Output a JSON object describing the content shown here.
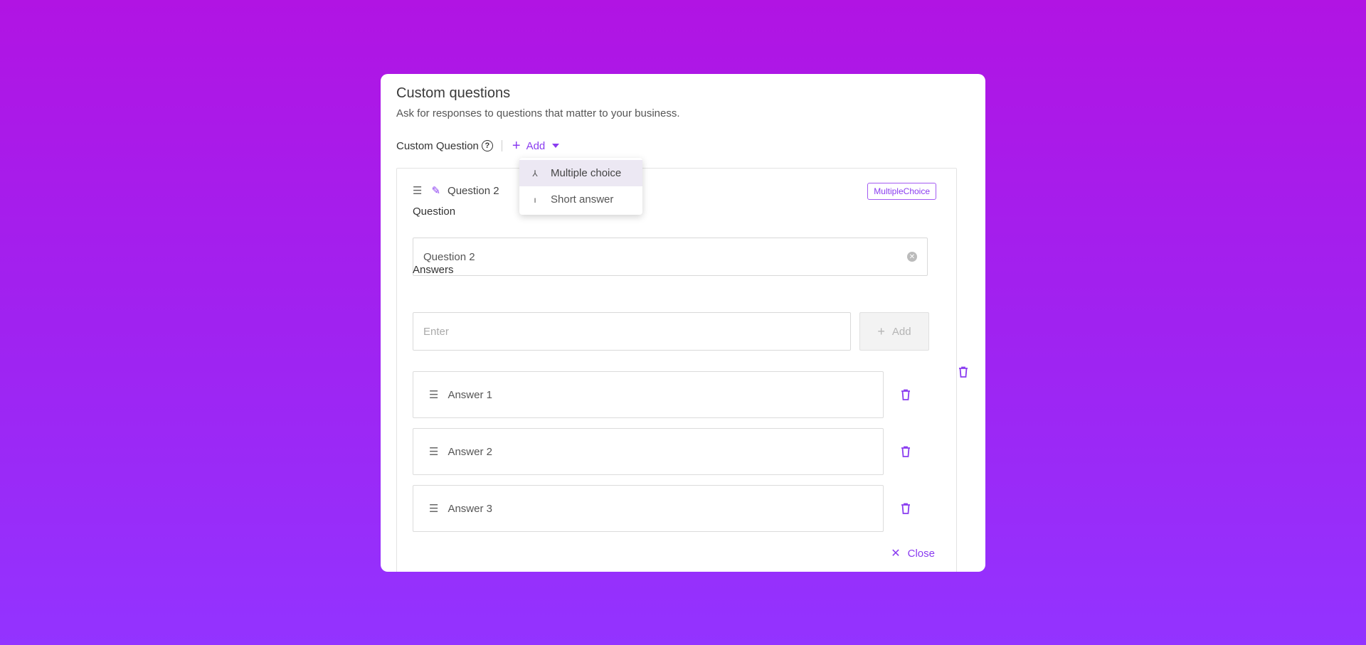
{
  "card": {
    "title": "Custom questions",
    "subtitle": "Ask for responses to questions that matter to your business.",
    "custom_question_label": "Custom Question",
    "help_icon": "question-circle-icon",
    "add_label": "Add"
  },
  "dropdown": {
    "items": [
      {
        "label": "Multiple choice",
        "icon": "branch-icon",
        "active": true
      },
      {
        "label": "Short answer",
        "icon": "short-line-icon",
        "active": false
      }
    ]
  },
  "question": {
    "header_title": "Question 2",
    "type_badge": "MultipleChoice",
    "question_label": "Question",
    "question_value": "Question 2",
    "answers_label": "Answers",
    "answer_placeholder": "Enter",
    "answer_add_label": "Add",
    "answers": [
      "Answer 1",
      "Answer 2",
      "Answer 3"
    ],
    "close_label": "Close"
  },
  "colors": {
    "accent": "#8a3cf0",
    "background_top": "#b114e3",
    "background_bottom": "#9333ff"
  }
}
